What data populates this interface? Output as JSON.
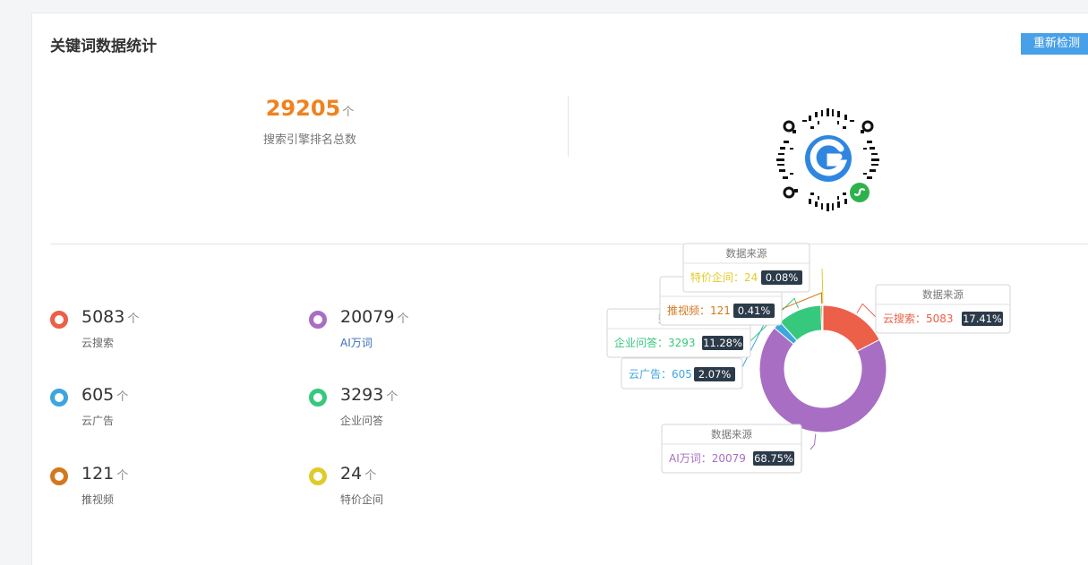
{
  "header": {
    "title": "关键词数据统计",
    "recheck_label": "重新检测"
  },
  "summary": {
    "total": "29205",
    "unit": "个",
    "label": "搜索引擎排名总数"
  },
  "stats": [
    {
      "value": "5083",
      "unit": "个",
      "label": "云搜索",
      "color": "#ec5f48"
    },
    {
      "value": "20079",
      "unit": "个",
      "label": "AI万词",
      "color": "#a76ec3"
    },
    {
      "value": "605",
      "unit": "个",
      "label": "云广告",
      "color": "#3ea6de"
    },
    {
      "value": "3293",
      "unit": "个",
      "label": "企业问答",
      "color": "#36c97e"
    },
    {
      "value": "121",
      "unit": "个",
      "label": "推视频",
      "color": "#d4781e"
    },
    {
      "value": "24",
      "unit": "个",
      "label": "特价企间",
      "color": "#e0cb2a"
    }
  ],
  "chart_data": {
    "type": "pie",
    "donut": true,
    "tooltip_title": "数据来源",
    "slices": [
      {
        "name": "云搜索",
        "value": 5083,
        "percent": "17.41%",
        "color": "#ec5f48"
      },
      {
        "name": "AI万词",
        "value": 20079,
        "percent": "68.75%",
        "color": "#a76ec3"
      },
      {
        "name": "云广告",
        "value": 605,
        "percent": "2.07%",
        "color": "#3ea6de"
      },
      {
        "name": "企业问答",
        "value": 3293,
        "percent": "11.28%",
        "color": "#36c97e"
      },
      {
        "name": "推视频",
        "value": 121,
        "percent": "0.41%",
        "color": "#d4781e"
      },
      {
        "name": "特价企间",
        "value": 24,
        "percent": "0.08%",
        "color": "#e0cb2a"
      }
    ]
  },
  "qr_code": {
    "icon": "mini-program-qr-code"
  }
}
